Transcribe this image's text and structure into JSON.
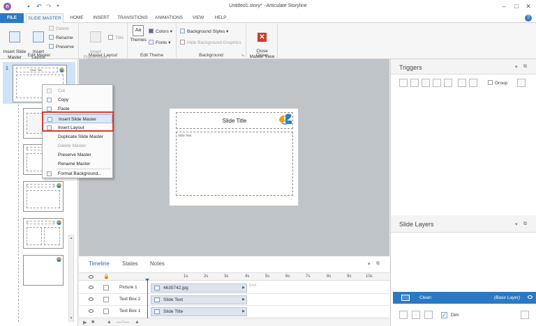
{
  "window": {
    "title": "Untitled1.story* - Articulate Storyline",
    "app_icon": "storyline-logo-icon",
    "quick_access": [
      "save-icon",
      "undo-icon",
      "redo-icon",
      "customize-dropdown-icon"
    ]
  },
  "tabs": [
    {
      "label": "FILE"
    },
    {
      "label": "SLIDE MASTER"
    },
    {
      "label": "HOME"
    },
    {
      "label": "INSERT"
    },
    {
      "label": "TRANSITIONS"
    },
    {
      "label": "ANIMATIONS"
    },
    {
      "label": "VIEW"
    },
    {
      "label": "HELP"
    }
  ],
  "ribbon": {
    "edit_master": {
      "label": "Edit Master",
      "insert_slide_master": "Insert Slide\nMaster",
      "insert_layout": "Insert\nLayout",
      "delete": "Delete",
      "rename": "Rename",
      "preserve": "Preserve"
    },
    "master_layout": {
      "label": "Master Layout",
      "insert_placeholder": "Insert\nPlaceholder",
      "title": "Title"
    },
    "edit_theme": {
      "label": "Edit Theme",
      "themes": "Themes",
      "colors": "Colors",
      "fonts": "Fonts"
    },
    "background": {
      "label": "Background",
      "background_styles": "Background Styles",
      "hide_background_graphics": "Hide Background Graphics"
    },
    "close": {
      "label": "Close",
      "close_master_view": "Close\nMaster View"
    }
  },
  "slides_panel": {
    "first_number": "1",
    "first_thumb_title": "Slide Title"
  },
  "context_menu": {
    "items": [
      {
        "label": "Cut",
        "enabled": false
      },
      {
        "label": "Copy",
        "enabled": true
      },
      {
        "label": "Paste",
        "enabled": true
      },
      {
        "label": "Insert Slide Master",
        "enabled": true,
        "highlighted": true
      },
      {
        "label": "Insert Layout",
        "enabled": true
      },
      {
        "label": "Duplicate Slide Master",
        "enabled": true
      },
      {
        "label": "Delete Master",
        "enabled": false
      },
      {
        "label": "Preserve Master",
        "enabled": true
      },
      {
        "label": "Rename Master",
        "enabled": true
      },
      {
        "label": "Format Background...",
        "enabled": true
      }
    ]
  },
  "slide": {
    "title": "Slide Title",
    "text_label": "Slide Text"
  },
  "timeline": {
    "tabs": [
      "Timeline",
      "States",
      "Notes"
    ],
    "ticks": [
      "1s",
      "2s",
      "3s",
      "4s",
      "5s",
      "6s",
      "7s",
      "8s",
      "9s",
      "10s"
    ],
    "end_label": "End",
    "rows": [
      {
        "name": "Picture 1",
        "bar_label": "4635742.jpg"
      },
      {
        "name": "Text Box 2",
        "bar_label": "Slide Text"
      },
      {
        "name": "Text Box 1",
        "bar_label": "Slide Title"
      }
    ]
  },
  "triggers": {
    "title": "Triggers",
    "group_label": "Group"
  },
  "slide_layers": {
    "title": "Slide Layers",
    "layer_name": "Clean",
    "base_label": "(Base Layer)",
    "dim_label": "Dim",
    "dim_checked": true
  }
}
